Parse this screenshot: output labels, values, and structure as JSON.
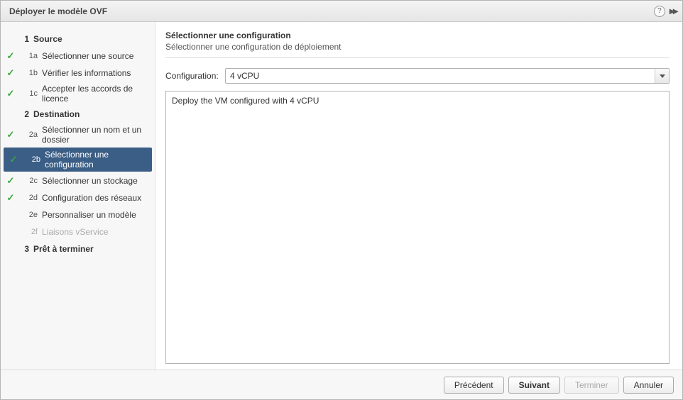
{
  "titlebar": {
    "title": "Déployer le modèle OVF"
  },
  "sidebar": {
    "section1": {
      "num": "1",
      "label": "Source"
    },
    "s1a": {
      "num": "1a",
      "label": "Sélectionner une source"
    },
    "s1b": {
      "num": "1b",
      "label": "Vérifier les informations"
    },
    "s1c": {
      "num": "1c",
      "label": "Accepter les accords de licence"
    },
    "section2": {
      "num": "2",
      "label": "Destination"
    },
    "s2a": {
      "num": "2a",
      "label": "Sélectionner un nom et un dossier"
    },
    "s2b": {
      "num": "2b",
      "label": "Sélectionner une configuration"
    },
    "s2c": {
      "num": "2c",
      "label": "Sélectionner un stockage"
    },
    "s2d": {
      "num": "2d",
      "label": "Configuration des réseaux"
    },
    "s2e": {
      "num": "2e",
      "label": "Personnaliser un modèle"
    },
    "s2f": {
      "num": "2f",
      "label": "Liaisons vService"
    },
    "section3": {
      "num": "3",
      "label": "Prêt à terminer"
    }
  },
  "main": {
    "title": "Sélectionner une configuration",
    "subtitle": "Sélectionner une configuration de déploiement",
    "config_label": "Configuration:",
    "config_value": "4 vCPU",
    "description": "Deploy the VM configured with 4 vCPU"
  },
  "footer": {
    "back": "Précédent",
    "next": "Suivant",
    "finish": "Terminer",
    "cancel": "Annuler"
  }
}
